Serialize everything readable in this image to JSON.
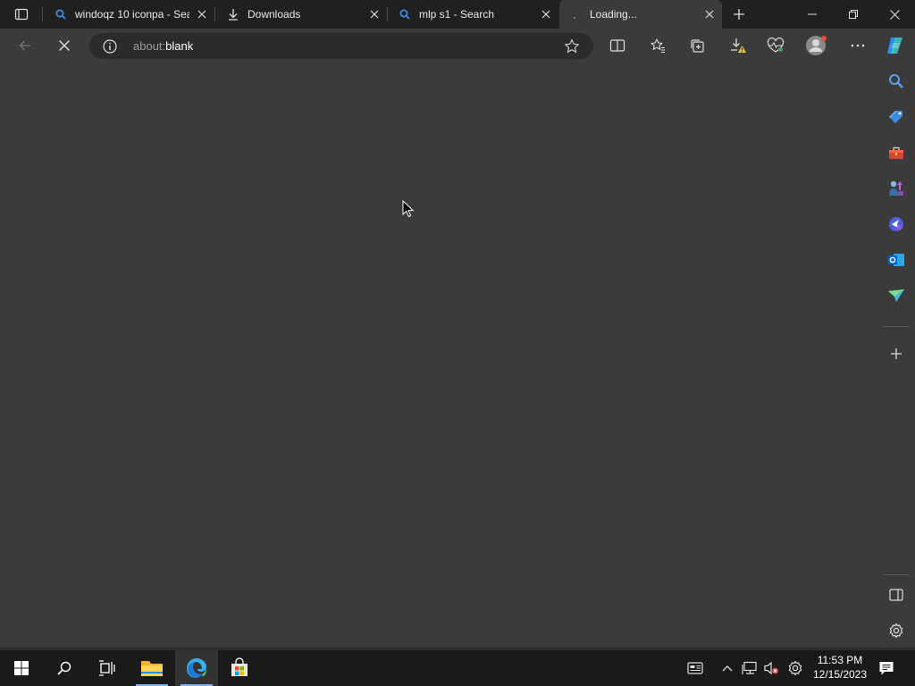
{
  "tabs": [
    {
      "title": "windoqz 10 iconpa - Sea",
      "icon": "search-icon"
    },
    {
      "title": "Downloads",
      "icon": "download-icon"
    },
    {
      "title": "mlp s1 - Search",
      "icon": "search-icon"
    },
    {
      "title": "Loading...",
      "icon": "loading-icon",
      "active": true
    }
  ],
  "address_bar": {
    "scheme": "about:",
    "path": "blank"
  },
  "sidebar_icons": [
    "search-icon",
    "shopping-tag-icon",
    "toolbox-icon",
    "games-icon",
    "copilot-icon",
    "outlook-icon",
    "send-icon",
    "add-icon",
    "split-screen-icon",
    "settings-icon"
  ],
  "taskbar": {
    "apps": [
      "start-icon",
      "search-icon",
      "task-view-icon",
      "file-explorer-icon",
      "edge-icon",
      "store-icon"
    ],
    "clock": {
      "time": "11:53 PM",
      "date": "12/15/2023"
    }
  },
  "colors": {
    "page_bg": "#3b3b3b",
    "tabstrip_bg": "#202020",
    "taskbar_bg": "#1a1a1a",
    "accent": "#7fb2ec"
  }
}
